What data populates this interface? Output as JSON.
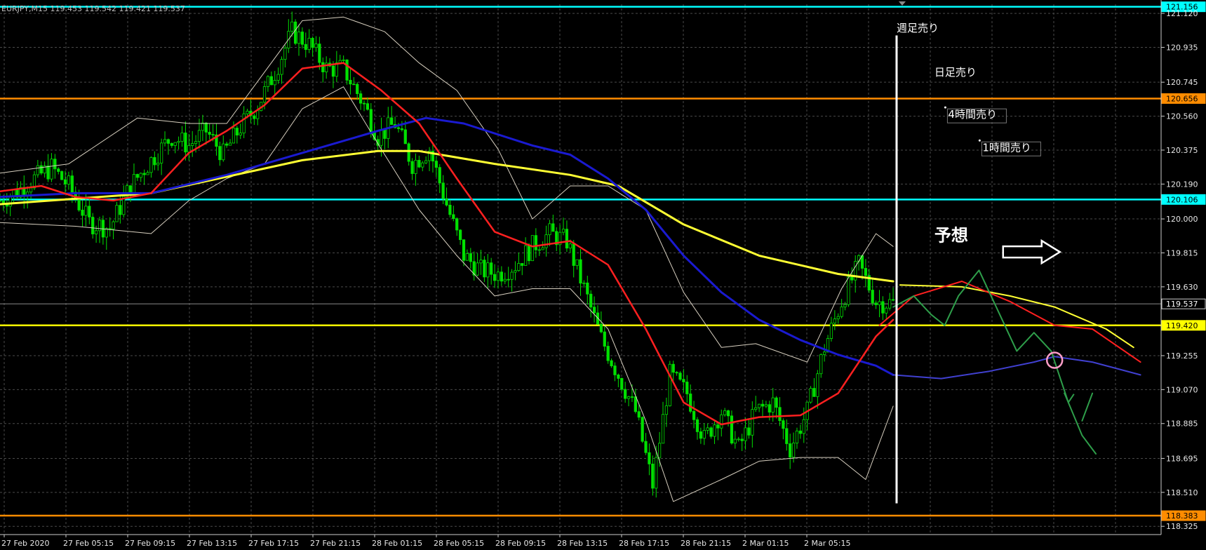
{
  "header": {
    "symbol_line": "EURJPY,M15  119.453 119.542 119.421 119.537"
  },
  "colors": {
    "background": "#000000",
    "grid": "#4a4a4a",
    "candle": "#00e000",
    "ma_fast": "#ff2020",
    "ma_mid": "#1a1ad0",
    "ma_slow": "#ffff33",
    "bollinger": "#d8d0c0",
    "cyan": "#00ffff",
    "orange": "#ff8c00",
    "forecast": "#2e9e4a",
    "forecast_red": "#ff2020",
    "forecast_yellow": "#ffff33",
    "forecast_blue": "#4040d0",
    "marker": "#ff9ec8"
  },
  "chart_data": {
    "type": "candlestick",
    "y_ticks": [
      "121.120",
      "120.935",
      "120.745",
      "120.560",
      "120.375",
      "120.190",
      "120.000",
      "119.815",
      "119.630",
      "119.255",
      "119.070",
      "118.885",
      "118.695",
      "118.510",
      "118.325"
    ],
    "ylim": [
      118.28,
      121.17
    ],
    "x_ticks": [
      "27 Feb 2020",
      "27 Feb 05:15",
      "27 Feb 09:15",
      "27 Feb 13:15",
      "27 Feb 17:15",
      "27 Feb 21:15",
      "28 Feb 01:15",
      "28 Feb 05:15",
      "28 Feb 09:15",
      "28 Feb 13:15",
      "28 Feb 17:15",
      "28 Feb 21:15",
      "2 Mar 01:15",
      "2 Mar 05:15"
    ],
    "x_index_range": [
      0,
      338
    ],
    "last_bar_index": 260,
    "horizontal_lines": [
      {
        "price": 121.156,
        "label": "121.156",
        "color": "cyan"
      },
      {
        "price": 120.656,
        "label": "120.656",
        "color": "orange"
      },
      {
        "price": 120.106,
        "label": "120.106",
        "color": "cyan"
      },
      {
        "price": 119.537,
        "label": "119.537",
        "color": "grid"
      },
      {
        "price": 119.42,
        "label": "119.420",
        "color": "yellow"
      },
      {
        "price": 118.383,
        "label": "118.383",
        "color": "orange"
      }
    ],
    "close_path": [
      [
        0,
        120.1
      ],
      [
        5,
        120.15
      ],
      [
        10,
        120.22
      ],
      [
        15,
        120.28
      ],
      [
        20,
        120.18
      ],
      [
        26,
        119.98
      ],
      [
        32,
        119.95
      ],
      [
        38,
        120.18
      ],
      [
        44,
        120.32
      ],
      [
        50,
        120.45
      ],
      [
        55,
        120.4
      ],
      [
        60,
        120.48
      ],
      [
        65,
        120.35
      ],
      [
        70,
        120.5
      ],
      [
        75,
        120.62
      ],
      [
        80,
        120.8
      ],
      [
        85,
        121.02
      ],
      [
        90,
        120.95
      ],
      [
        95,
        120.82
      ],
      [
        100,
        120.82
      ],
      [
        106,
        120.62
      ],
      [
        110,
        120.45
      ],
      [
        115,
        120.52
      ],
      [
        120,
        120.3
      ],
      [
        125,
        120.38
      ],
      [
        130,
        120.08
      ],
      [
        135,
        119.8
      ],
      [
        140,
        119.72
      ],
      [
        145,
        119.7
      ],
      [
        150,
        119.75
      ],
      [
        155,
        119.85
      ],
      [
        160,
        119.92
      ],
      [
        165,
        119.88
      ],
      [
        170,
        119.62
      ],
      [
        175,
        119.35
      ],
      [
        180,
        119.15
      ],
      [
        185,
        118.95
      ],
      [
        190,
        118.55
      ],
      [
        195,
        119.15
      ],
      [
        200,
        119.05
      ],
      [
        205,
        118.8
      ],
      [
        210,
        118.95
      ],
      [
        215,
        118.75
      ],
      [
        220,
        118.95
      ],
      [
        225,
        119.0
      ],
      [
        230,
        118.75
      ],
      [
        235,
        118.95
      ],
      [
        240,
        119.3
      ],
      [
        245,
        119.55
      ],
      [
        250,
        119.75
      ],
      [
        255,
        119.55
      ],
      [
        260,
        119.54
      ]
    ],
    "ma_fast": [
      [
        0,
        120.15
      ],
      [
        12,
        120.18
      ],
      [
        22,
        120.12
      ],
      [
        33,
        120.1
      ],
      [
        44,
        120.14
      ],
      [
        55,
        120.36
      ],
      [
        66,
        120.48
      ],
      [
        77,
        120.62
      ],
      [
        88,
        120.82
      ],
      [
        100,
        120.85
      ],
      [
        111,
        120.7
      ],
      [
        122,
        120.52
      ],
      [
        133,
        120.22
      ],
      [
        144,
        119.93
      ],
      [
        155,
        119.85
      ],
      [
        166,
        119.88
      ],
      [
        177,
        119.75
      ],
      [
        188,
        119.4
      ],
      [
        199,
        119.0
      ],
      [
        210,
        118.88
      ],
      [
        221,
        118.92
      ],
      [
        233,
        118.93
      ],
      [
        244,
        119.05
      ],
      [
        255,
        119.36
      ],
      [
        260,
        119.45
      ]
    ],
    "ma_mid": [
      [
        0,
        120.12
      ],
      [
        22,
        120.14
      ],
      [
        44,
        120.14
      ],
      [
        66,
        120.24
      ],
      [
        88,
        120.36
      ],
      [
        110,
        120.48
      ],
      [
        124,
        120.55
      ],
      [
        135,
        120.52
      ],
      [
        155,
        120.4
      ],
      [
        166,
        120.35
      ],
      [
        177,
        120.22
      ],
      [
        188,
        120.05
      ],
      [
        199,
        119.8
      ],
      [
        210,
        119.6
      ],
      [
        221,
        119.45
      ],
      [
        233,
        119.34
      ],
      [
        244,
        119.26
      ],
      [
        255,
        119.2
      ],
      [
        260,
        119.15
      ]
    ],
    "ma_slow": [
      [
        0,
        120.08
      ],
      [
        44,
        120.14
      ],
      [
        88,
        120.32
      ],
      [
        110,
        120.37
      ],
      [
        122,
        120.37
      ],
      [
        144,
        120.3
      ],
      [
        166,
        120.24
      ],
      [
        180,
        120.18
      ],
      [
        199,
        119.97
      ],
      [
        221,
        119.8
      ],
      [
        244,
        119.7
      ],
      [
        260,
        119.66
      ]
    ],
    "bollinger_upper": [
      [
        0,
        120.25
      ],
      [
        20,
        120.3
      ],
      [
        40,
        120.55
      ],
      [
        55,
        120.52
      ],
      [
        66,
        120.52
      ],
      [
        77,
        120.8
      ],
      [
        88,
        121.08
      ],
      [
        100,
        121.1
      ],
      [
        112,
        121.02
      ],
      [
        122,
        120.85
      ],
      [
        133,
        120.7
      ],
      [
        145,
        120.38
      ],
      [
        155,
        120.0
      ],
      [
        166,
        120.18
      ],
      [
        177,
        120.18
      ],
      [
        188,
        120.05
      ],
      [
        199,
        119.6
      ],
      [
        210,
        119.3
      ],
      [
        220,
        119.32
      ],
      [
        235,
        119.22
      ],
      [
        245,
        119.62
      ],
      [
        255,
        119.92
      ],
      [
        260,
        119.85
      ]
    ],
    "bollinger_lower": [
      [
        0,
        119.98
      ],
      [
        22,
        119.96
      ],
      [
        44,
        119.92
      ],
      [
        55,
        120.1
      ],
      [
        66,
        120.22
      ],
      [
        77,
        120.3
      ],
      [
        88,
        120.6
      ],
      [
        100,
        120.72
      ],
      [
        111,
        120.38
      ],
      [
        122,
        120.05
      ],
      [
        133,
        119.8
      ],
      [
        144,
        119.58
      ],
      [
        155,
        119.62
      ],
      [
        166,
        119.62
      ],
      [
        177,
        119.4
      ],
      [
        188,
        118.9
      ],
      [
        196,
        118.46
      ],
      [
        210,
        118.58
      ],
      [
        221,
        118.68
      ],
      [
        233,
        118.7
      ],
      [
        244,
        118.7
      ],
      [
        252,
        118.58
      ],
      [
        260,
        118.98
      ]
    ],
    "forecast": {
      "label": "予想",
      "green": [
        [
          260,
          119.52
        ],
        [
          266,
          119.58
        ],
        [
          271,
          119.48
        ],
        [
          275,
          119.42
        ],
        [
          279,
          119.58
        ],
        [
          285,
          119.72
        ],
        [
          290,
          119.52
        ],
        [
          296,
          119.28
        ],
        [
          301,
          119.38
        ],
        [
          306,
          119.28
        ],
        [
          311,
          119.0
        ],
        [
          315,
          118.82
        ],
        [
          319,
          118.72
        ]
      ],
      "green_tail": [
        [
          315,
          118.9
        ],
        [
          318,
          119.05
        ]
      ],
      "red": [
        [
          256,
          119.42
        ],
        [
          266,
          119.58
        ],
        [
          280,
          119.66
        ],
        [
          294,
          119.55
        ],
        [
          307,
          119.42
        ],
        [
          318,
          119.4
        ],
        [
          332,
          119.22
        ]
      ],
      "yellow": [
        [
          262,
          119.64
        ],
        [
          280,
          119.63
        ],
        [
          294,
          119.58
        ],
        [
          307,
          119.52
        ],
        [
          322,
          119.4
        ],
        [
          330,
          119.3
        ]
      ],
      "blue": [
        [
          260,
          119.15
        ],
        [
          274,
          119.13
        ],
        [
          288,
          119.17
        ],
        [
          301,
          119.22
        ],
        [
          307,
          119.25
        ],
        [
          318,
          119.22
        ],
        [
          332,
          119.15
        ]
      ],
      "marker": [
        307,
        119.23
      ]
    },
    "annotations": [
      {
        "text": "週足売り",
        "index": 261,
        "price": 121.02
      },
      {
        "text": "日足売り",
        "index": 272,
        "price": 120.78
      },
      {
        "text": "4時間売り",
        "index": 276,
        "price": 120.55
      },
      {
        "text": "1時間売り",
        "index": 286,
        "price": 120.37
      }
    ],
    "vertical_marker_index": 261
  }
}
